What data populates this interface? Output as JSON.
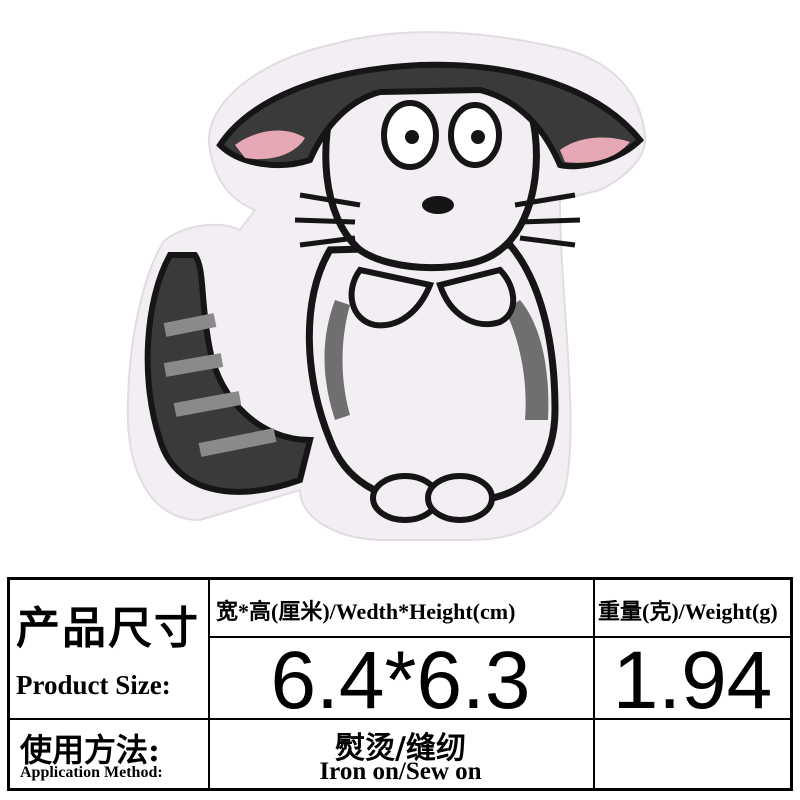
{
  "colors": {
    "felt": "#f3eef3",
    "thread_black": "#151515",
    "thread_gray": "#6f6f6f",
    "ear_pink": "#e6a8b5",
    "border": "#000000"
  },
  "spec": {
    "product_size_zh": "产品尺寸",
    "product_size_en": "Product Size:",
    "dimension_header": "宽*高(厘米)/Wedth*Height(cm)",
    "dimension_value": "6.4*6.3",
    "weight_header": "重量(克)/Weight(g)",
    "weight_value": "1.94",
    "method_zh": "使用方法:",
    "method_en": "Application Method:",
    "method_value_zh": "熨烫/缝纫",
    "method_value_en": "Iron on/Sew on"
  }
}
